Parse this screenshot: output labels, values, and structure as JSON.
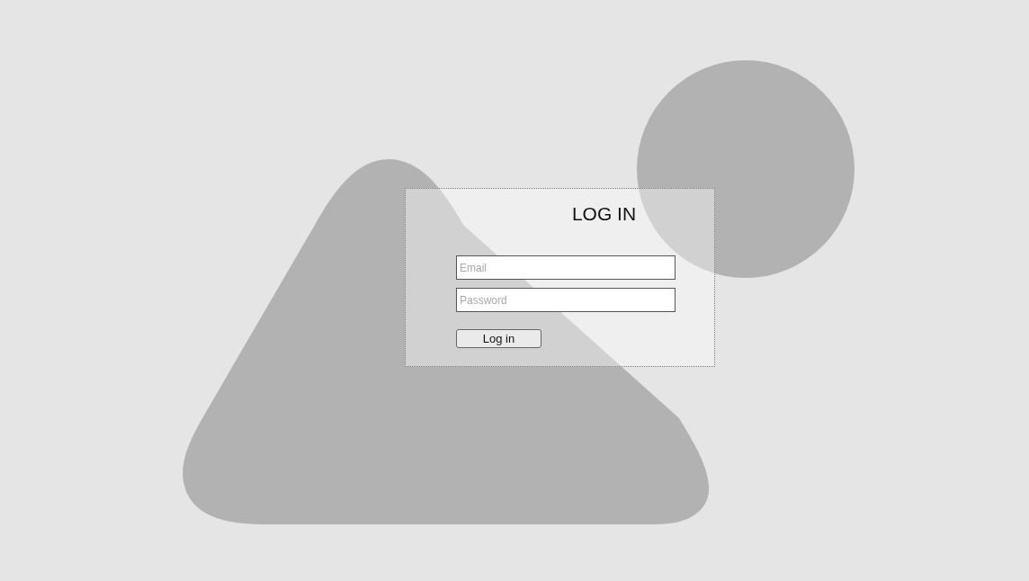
{
  "login_form": {
    "title": "LOG IN",
    "fields": [
      {
        "placeholder": "Email"
      },
      {
        "placeholder": "Password"
      }
    ],
    "button": "Log in"
  }
}
